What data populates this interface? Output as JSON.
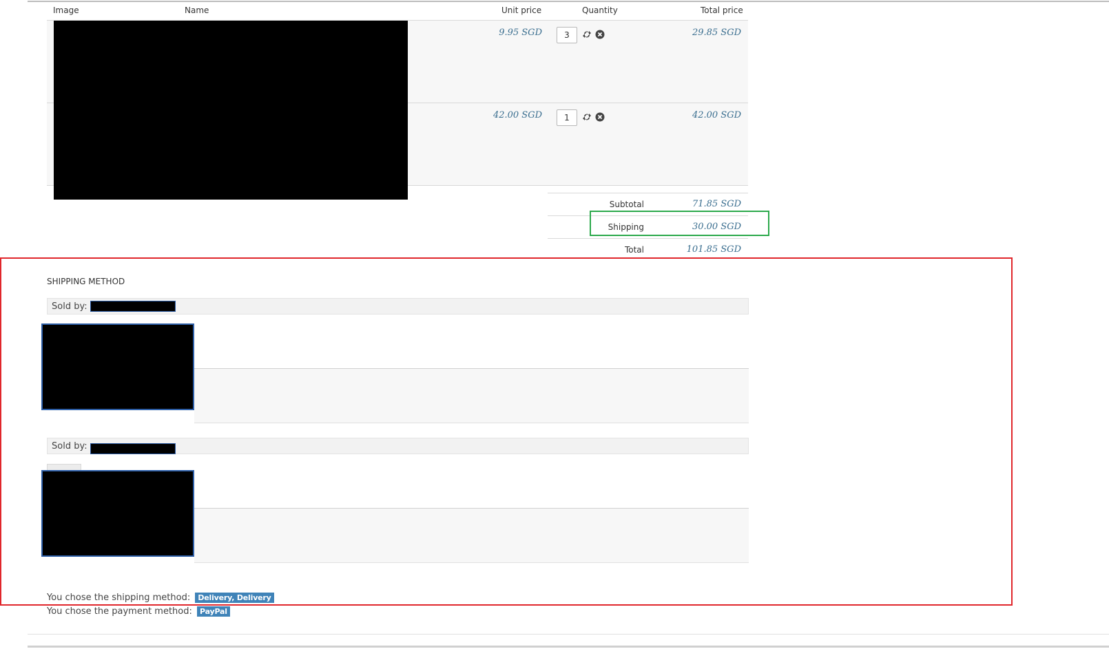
{
  "table": {
    "headers": {
      "image": "Image",
      "name": "Name",
      "unit_price": "Unit price",
      "quantity": "Quantity",
      "total_price": "Total price"
    },
    "rows": [
      {
        "unit_price": "9.95 SGD",
        "quantity": "3",
        "total_price": "29.85 SGD"
      },
      {
        "unit_price": "42.00 SGD",
        "quantity": "1",
        "total_price": "42.00 SGD"
      }
    ]
  },
  "summary": {
    "subtotal_label": "Subtotal",
    "subtotal_value": "71.85 SGD",
    "shipping_label": "Shipping",
    "shipping_value": "30.00 SGD",
    "total_label": "Total",
    "total_value": "101.85 SGD"
  },
  "shipping_method": {
    "heading": "SHIPPING METHOD",
    "sellers": [
      {
        "sold_by_label": "Sold by:"
      },
      {
        "sold_by_label": "Sold by:"
      }
    ],
    "chosen_shipping_prefix": "You chose the shipping method:",
    "chosen_shipping_value": "Delivery, Delivery",
    "chosen_payment_prefix": "You chose the payment method:",
    "chosen_payment_value": "PayPal"
  },
  "icons": {
    "refresh": "refresh-icon",
    "remove": "remove-icon"
  },
  "colors": {
    "price": "#3a6e8f",
    "badge": "#3f83b8",
    "highlight_red": "#e0262b",
    "highlight_green": "#2aa84a"
  }
}
